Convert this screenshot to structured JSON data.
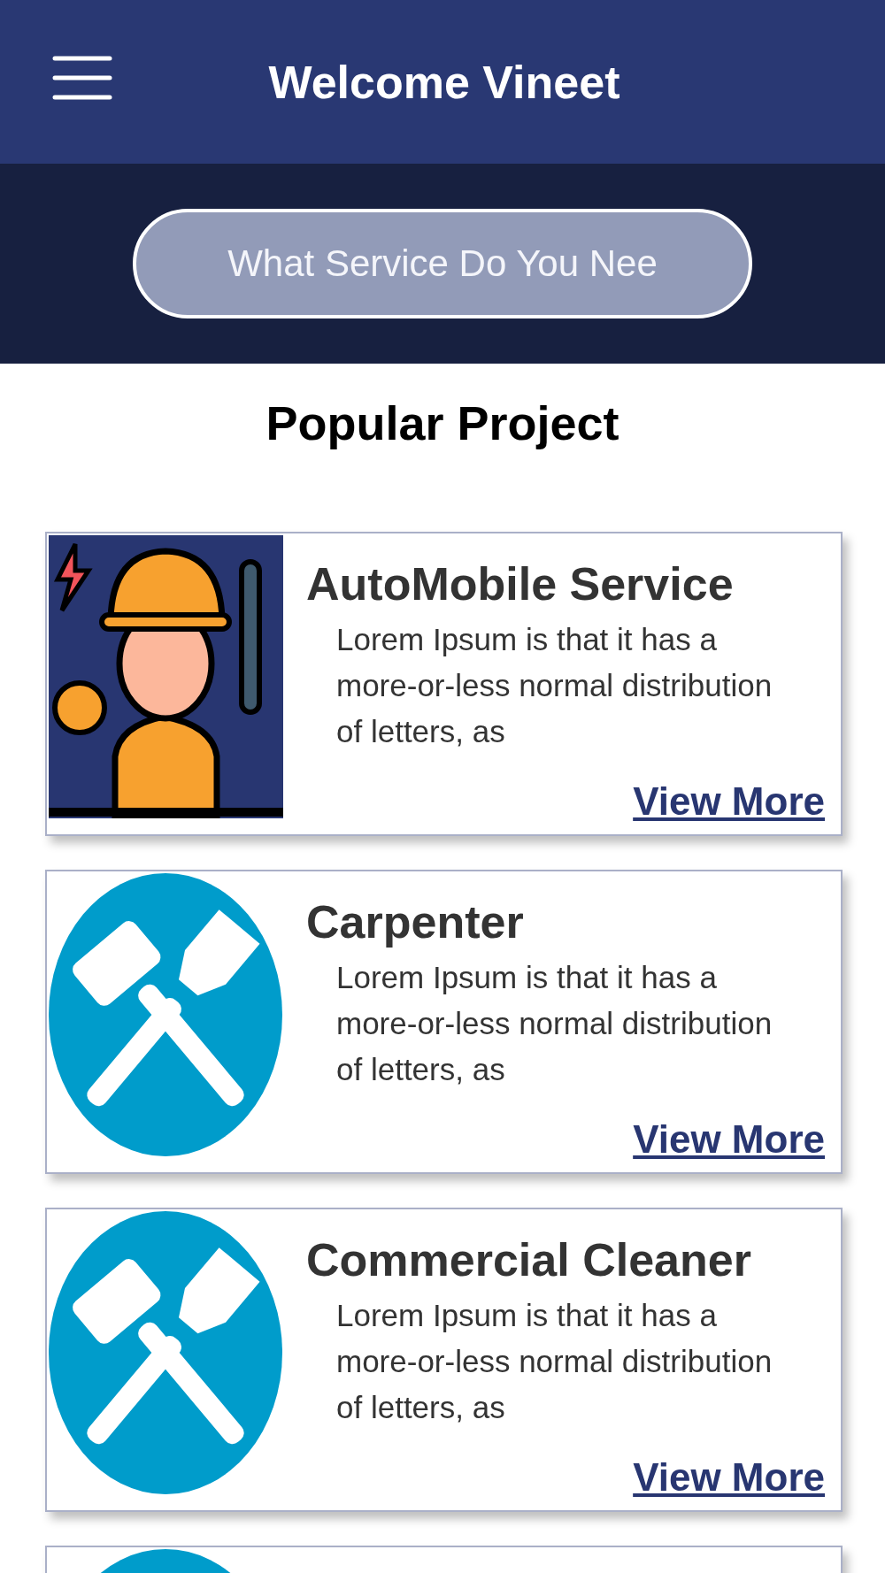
{
  "header": {
    "title": "Welcome Vineet"
  },
  "search": {
    "placeholder": "What Service Do You Nee"
  },
  "section": {
    "title": "Popular Project"
  },
  "cards": [
    {
      "kind": "worker",
      "title": "AutoMobile Service",
      "description": "Lorem Ipsum is that it has a more-or-less normal distribution of letters, as",
      "link": "View More"
    },
    {
      "kind": "tools",
      "title": "Carpenter",
      "description": "Lorem Ipsum is that it has a more-or-less normal distribution of letters, as",
      "link": "View More"
    },
    {
      "kind": "tools",
      "title": "Commercial Cleaner",
      "description": "Lorem Ipsum is that it has a more-or-less normal distribution of letters, as",
      "link": "View More"
    },
    {
      "kind": "tools"
    }
  ]
}
